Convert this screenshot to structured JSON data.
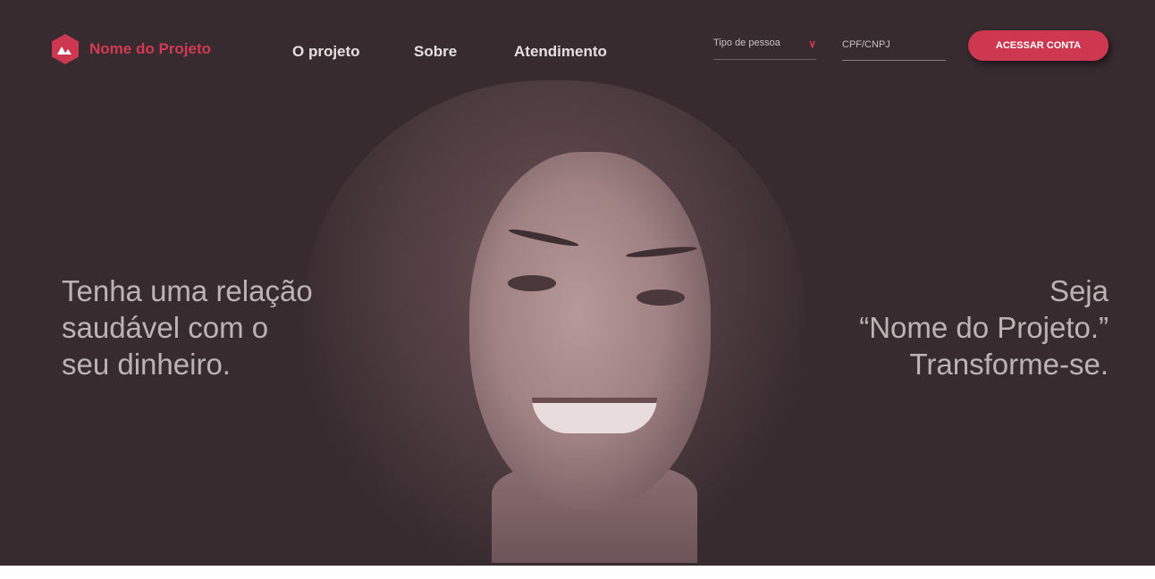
{
  "brand": {
    "name": "Nome do Projeto",
    "accent": "#cd3750"
  },
  "nav": [
    "O projeto",
    "Sobre",
    "Atendimento"
  ],
  "form": {
    "select_label": "Tipo de pessoa",
    "input_placeholder": "CPF/CNPJ",
    "button": "ACESSAR CONTA"
  },
  "hero": {
    "left": [
      "Tenha uma relação",
      "saudável com o",
      "seu dinheiro."
    ],
    "right": [
      "Seja",
      "“Nome do Projeto.”",
      "Transforme-se."
    ]
  }
}
